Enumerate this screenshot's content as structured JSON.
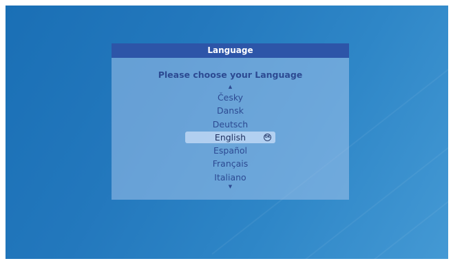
{
  "dialog": {
    "title": "Language",
    "prompt": "Please choose your Language",
    "scroll_up_glyph": "▲",
    "scroll_down_glyph": "▼",
    "languages": [
      "Česky",
      "Dansk",
      "Deutsch",
      "English",
      "Español",
      "Français",
      "Italiano"
    ],
    "selected_language": "English",
    "ok_icon_label": "OK"
  },
  "colors": {
    "background": "#1f73b8",
    "header": "#2d55a8",
    "text": "#2c4a92"
  }
}
